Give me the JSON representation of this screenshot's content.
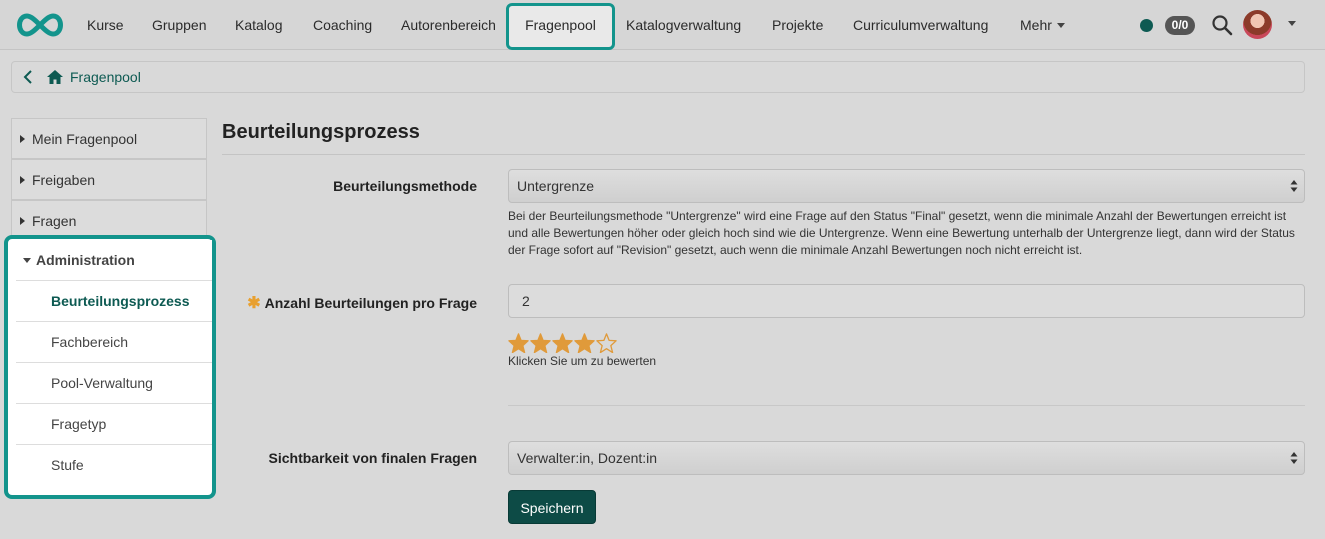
{
  "nav": {
    "items": [
      "Kurse",
      "Gruppen",
      "Katalog",
      "Coaching",
      "Autorenbereich",
      "Fragenpool",
      "Katalogverwaltung",
      "Projekte",
      "Curriculumverwaltung",
      "Mehr"
    ],
    "active": "Fragenpool",
    "badge": "0/0",
    "status_color": "#0d5a52"
  },
  "breadcrumb": {
    "label": "Fragenpool"
  },
  "sidebar": {
    "items": [
      "Mein Fragenpool",
      "Freigaben",
      "Fragen"
    ],
    "admin": {
      "label": "Administration",
      "items": [
        "Beurteilungsprozess",
        "Fachbereich",
        "Pool-Verwaltung",
        "Fragetyp",
        "Stufe"
      ],
      "active": "Beurteilungsprozess"
    }
  },
  "main": {
    "title": "Beurteilungsprozess",
    "method": {
      "label": "Beurteilungsmethode",
      "value": "Untergrenze",
      "help": "Bei der Beurteilungsmethode \"Untergrenze\" wird eine Frage auf den Status \"Final\" gesetzt, wenn die minimale Anzahl der Bewertungen erreicht ist und alle Bewertungen höher oder gleich hoch sind wie die Untergrenze. Wenn eine Bewertung unterhalb der Untergrenze liegt, dann wird der Status der Frage sofort auf \"Revision\" gesetzt, auch wenn die minimale Anzahl Bewertungen noch nicht erreicht ist."
    },
    "count": {
      "required_mark": "✱",
      "label": "Anzahl Beurteilungen pro Frage",
      "value": "2"
    },
    "rating": {
      "value": 4,
      "max": 5,
      "hint": "Klicken Sie um zu bewerten",
      "color": "#e09a3a"
    },
    "visibility": {
      "label": "Sichtbarkeit von finalen Fragen",
      "value": "Verwalter:in, Dozent:in"
    },
    "save_label": "Speichern"
  },
  "colors": {
    "accent": "#13948c",
    "primary": "#0d4b46"
  }
}
